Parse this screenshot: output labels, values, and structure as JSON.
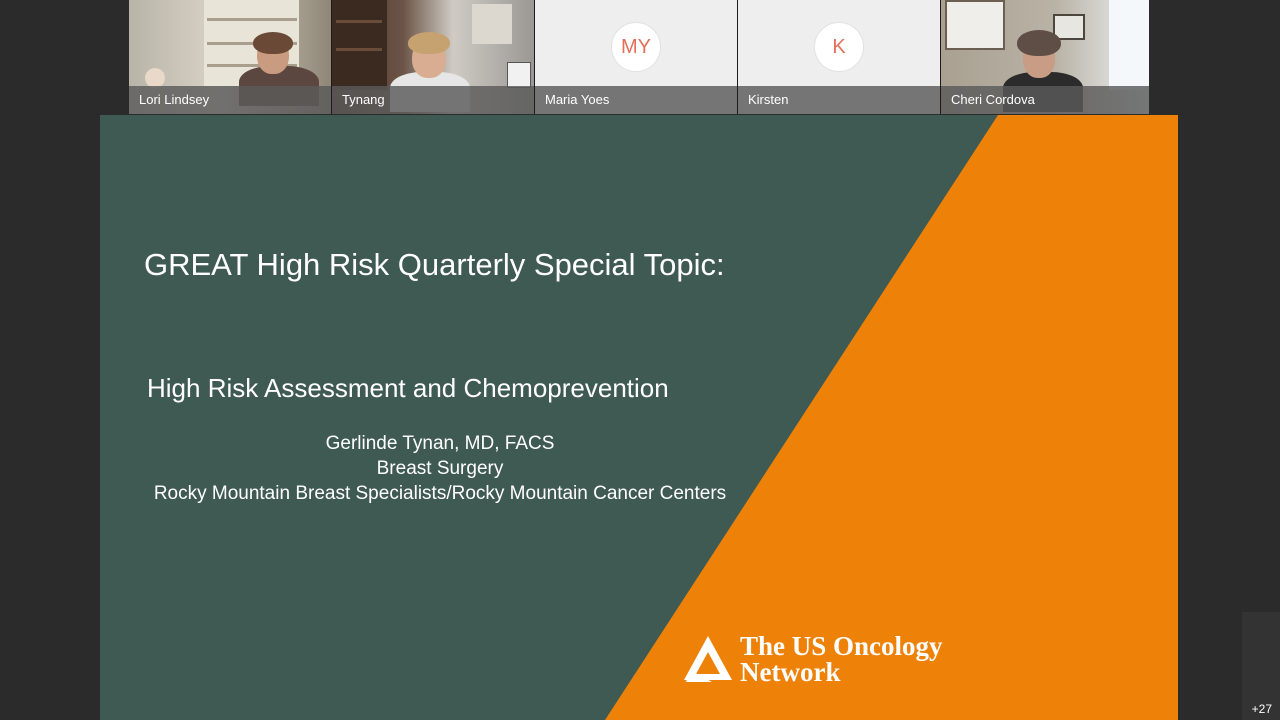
{
  "participants": [
    {
      "name": "Lori Lindsey",
      "type": "video"
    },
    {
      "name": "Tynang",
      "type": "video"
    },
    {
      "name": "Maria Yoes",
      "type": "avatar",
      "initials": "MY"
    },
    {
      "name": "Kirsten",
      "type": "avatar",
      "initials": "K"
    },
    {
      "name": "Cheri Cordova",
      "type": "video"
    }
  ],
  "slide": {
    "title": "GREAT High Risk Quarterly Special Topic:",
    "subtitle": "High Risk Assessment and Chemoprevention",
    "presenter_name": "Gerlinde Tynan, MD, FACS",
    "presenter_specialty": "Breast Surgery",
    "presenter_affiliation": "Rocky Mountain Breast Specialists/Rocky Mountain Cancer Centers",
    "logo_line1": "The US Oncology",
    "logo_line2": "Network",
    "colors": {
      "green": "#3f5a52",
      "orange": "#ee8208"
    }
  },
  "more_participants": "+27"
}
